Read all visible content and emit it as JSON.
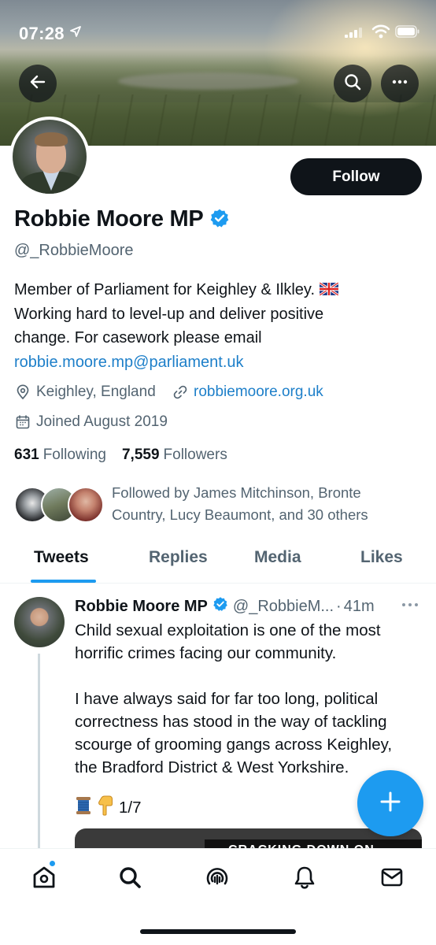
{
  "status_bar": {
    "time": "07:28"
  },
  "profile": {
    "name": "Robbie Moore MP",
    "handle": "@_RobbieMoore",
    "follow_label": "Follow",
    "bio_line1": "Member of Parliament for Keighley & Ilkley.",
    "bio_line2": "Working hard to level-up and deliver positive",
    "bio_line3": "change. For casework please email",
    "bio_email": "robbie.moore.mp@parliament.uk",
    "location": "Keighley, England",
    "website": "robbiemoore.org.uk",
    "joined": "Joined August 2019",
    "following_count": "631",
    "following_label": "Following",
    "followers_count": "7,559",
    "followers_label": "Followers",
    "followed_by_line1": "Followed by James Mitchinson, Bronte",
    "followed_by_line2": "Country, Lucy Beaumont, and 30 others"
  },
  "tabs": [
    {
      "label": "Tweets",
      "active": true
    },
    {
      "label": "Replies",
      "active": false
    },
    {
      "label": "Media",
      "active": false
    },
    {
      "label": "Likes",
      "active": false
    }
  ],
  "tweet": {
    "name": "Robbie Moore MP",
    "handle": "@_RobbieM...",
    "dot": "·",
    "time": "41m",
    "line1": "Child sexual exploitation is one of the most",
    "line2": "horrific crimes facing our community.",
    "line3": "I have always said for far too long, political",
    "line4": "correctness has stood in the way of tackling",
    "line5": "scourge of grooming gangs across Keighley,",
    "line6": "the Bradford District & West Yorkshire.",
    "thread_count": "1/7",
    "media_text": "CRACKING DOWN ON"
  },
  "colors": {
    "accent": "#1d9bf0",
    "link": "#1d7fc9",
    "text": "#0f1419",
    "secondary": "#536471"
  },
  "icons": [
    "back-arrow-icon",
    "search-icon",
    "more-icon",
    "verified-badge-icon",
    "uk-flag-icon",
    "location-pin-icon",
    "link-icon",
    "calendar-icon",
    "compose-plus-icon",
    "home-icon",
    "spaces-icon",
    "bell-icon",
    "mail-icon"
  ]
}
